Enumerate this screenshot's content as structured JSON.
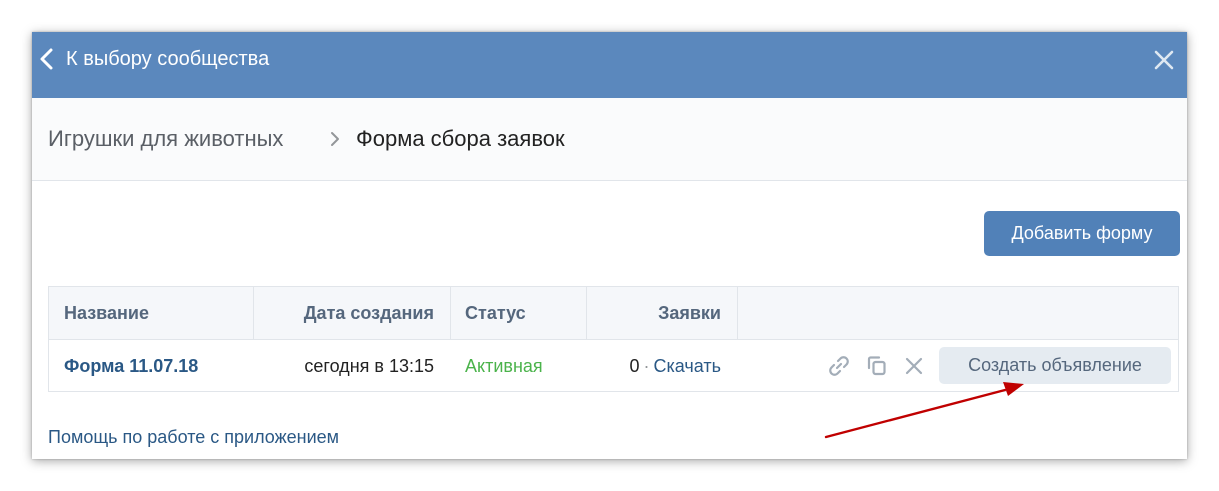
{
  "header": {
    "back_label": "К выбору сообщества"
  },
  "breadcrumb": {
    "parent": "Игрушки для животных",
    "current": "Форма сбора заявок"
  },
  "toolbar": {
    "add_form_label": "Добавить форму"
  },
  "table": {
    "columns": [
      "Название",
      "Дата создания",
      "Статус",
      "Заявки"
    ],
    "rows": [
      {
        "name": "Форма 11.07.18",
        "created": "сегодня в 13:15",
        "status": "Активная",
        "requests_count": "0",
        "download_label": "Скачать",
        "create_ad_label": "Создать объявление"
      }
    ]
  },
  "footer": {
    "help_link": "Помощь по работе с приложением"
  },
  "colors": {
    "header_bg": "#5b88bd",
    "primary_button": "#5181b8",
    "link": "#2a5885",
    "status_active": "#4bb34b",
    "annotation_arrow": "#c00000"
  },
  "icons": [
    "chevron-left-icon",
    "close-icon",
    "chevron-right-icon",
    "link-icon",
    "copy-icon",
    "delete-icon"
  ]
}
